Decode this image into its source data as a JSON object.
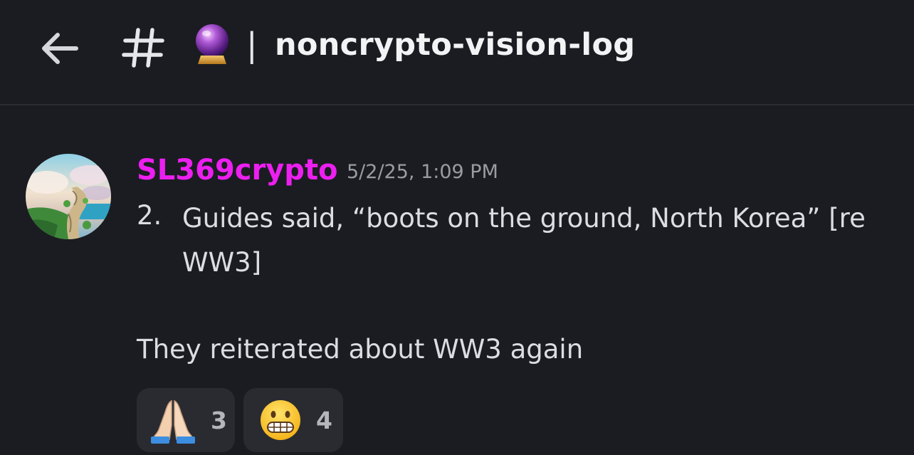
{
  "header": {
    "back_icon": "arrow-left-icon",
    "channel_type_icon": "hash-icon",
    "channel_emoji_icon": "crystal-ball-icon",
    "separator": "|",
    "channel_name": "noncrypto-vision-log"
  },
  "message": {
    "author": "SL369crypto",
    "author_color": "#ec1ff0",
    "timestamp": "5/2/25, 1:09 PM",
    "list_item": {
      "number": "2.",
      "text": "Guides said, “boots on the ground, North Korea” [re WW3]"
    },
    "body": "They reiterated about WW3 again",
    "reactions": [
      {
        "icon": "folded-hands-icon",
        "count": "3"
      },
      {
        "icon": "grimacing-face-icon",
        "count": "4"
      }
    ]
  },
  "colors": {
    "background": "#1b1c21",
    "divider": "#2b2c33",
    "reaction_bg": "#2a2b31"
  }
}
